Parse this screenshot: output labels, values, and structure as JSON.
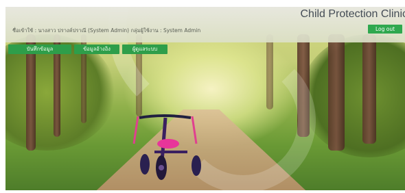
{
  "header": {
    "app_title": "Child Protection Clinic",
    "login_info": "ชื่อเข้าใช้ : นางสาว ปรางค์ปราณี (System Admin)     กลุ่มผู้ใช้งาน : System Admin",
    "logout_label": "Log out"
  },
  "nav": {
    "items": [
      {
        "label": "บันทึกข้อมูล"
      },
      {
        "label": "ข้อมูลอ้างอิง"
      },
      {
        "label": "ผู้ดูแลระบบ"
      }
    ]
  },
  "colors": {
    "accent_green": "#2e9e4a",
    "title_text": "#444c55"
  },
  "hero": {
    "image_icon": "tricycle-icon"
  }
}
